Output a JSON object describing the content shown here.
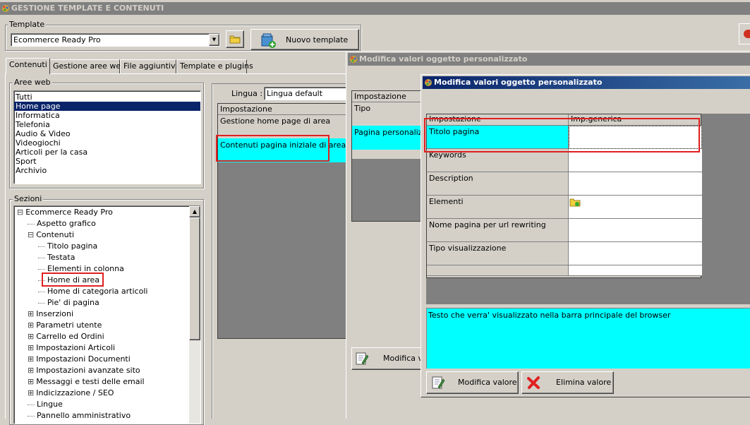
{
  "app": {
    "title": "GESTIONE TEMPLATE E CONTENUTI",
    "template_label": "Template",
    "template_value": "Ecommerce Ready Pro",
    "nuovo_template": "Nuovo template"
  },
  "tabs": [
    "Contenuti",
    "Gestione aree web",
    "File aggiuntivi",
    "Template e plugins"
  ],
  "aree_web": {
    "label": "Aree web",
    "items": [
      "Tutti",
      "Home page",
      "Informatica",
      "Telefonia",
      "Audio & Video",
      "Videogiochi",
      "Articoli per la casa",
      "Sport",
      "Archivio"
    ],
    "selected_index": 1
  },
  "sezioni": {
    "label": "Sezioni",
    "tree": [
      {
        "label": "Ecommerce Ready Pro",
        "level": 0,
        "box": "⊟"
      },
      {
        "label": "Aspetto grafico",
        "level": 1,
        "box": ""
      },
      {
        "label": "Contenuti",
        "level": 1,
        "box": "⊟"
      },
      {
        "label": "Titolo pagina",
        "level": 2,
        "box": ""
      },
      {
        "label": "Testata",
        "level": 2,
        "box": ""
      },
      {
        "label": "Elementi in colonna",
        "level": 2,
        "box": ""
      },
      {
        "label": "Home di area",
        "level": 2,
        "box": ""
      },
      {
        "label": "Home di categoria articoli",
        "level": 2,
        "box": ""
      },
      {
        "label": "Pie' di pagina",
        "level": 2,
        "box": ""
      },
      {
        "label": "Inserzioni",
        "level": 1,
        "box": "⊞"
      },
      {
        "label": "Parametri utente",
        "level": 1,
        "box": "⊞"
      },
      {
        "label": "Carrello ed Ordini",
        "level": 1,
        "box": "⊞"
      },
      {
        "label": "Impostazioni Articoli",
        "level": 1,
        "box": "⊞"
      },
      {
        "label": "Impostazioni Documenti",
        "level": 1,
        "box": "⊞"
      },
      {
        "label": "Impostazioni avanzate sito",
        "level": 1,
        "box": "⊞"
      },
      {
        "label": "Messaggi e testi delle email",
        "level": 1,
        "box": "⊞"
      },
      {
        "label": "Indicizzazione / SEO",
        "level": 1,
        "box": "⊞"
      },
      {
        "label": "Lingue",
        "level": 1,
        "box": ""
      },
      {
        "label": "Pannello amministrativo",
        "level": 1,
        "box": ""
      }
    ]
  },
  "lingua": {
    "label": "Lingua :",
    "value": "Lingua default"
  },
  "main_grid": {
    "header": "Impostazione",
    "rows": [
      "Gestione home page di area",
      "Contenuti pagina iniziale di area"
    ]
  },
  "dialog1": {
    "title": "Modifica valori oggetto personalizzato",
    "header": "Impostazione",
    "rows": [
      "Tipo",
      "Pagina personalizza"
    ],
    "modifica_button": "Modifica va"
  },
  "dialog2": {
    "title": "Modifica valori oggetto personalizzato",
    "header_col1": "Impostazione",
    "header_col2": "Imp.generica",
    "rows": [
      {
        "label": "Titolo pagina",
        "value": ""
      },
      {
        "label": "Keywords",
        "value": ""
      },
      {
        "label": "Description",
        "value": ""
      },
      {
        "label": "Elementi",
        "value": ""
      },
      {
        "label": "Nome pagina per url rewriting",
        "value": ""
      },
      {
        "label": "Tipo visualizzazione",
        "value": ""
      },
      {
        "label": "",
        "value": ""
      }
    ],
    "description_text": "Testo che verra' visualizzato nella barra principale del browser",
    "modifica_valore": "Modifica valore",
    "elimina_valore": "Elimina valore"
  },
  "colors": {
    "cyan": "#00ffff",
    "selection": "#0a246a",
    "highlight_red": "#e02020",
    "window_bg": "#d4d0c8",
    "dark_panel": "#808080"
  }
}
